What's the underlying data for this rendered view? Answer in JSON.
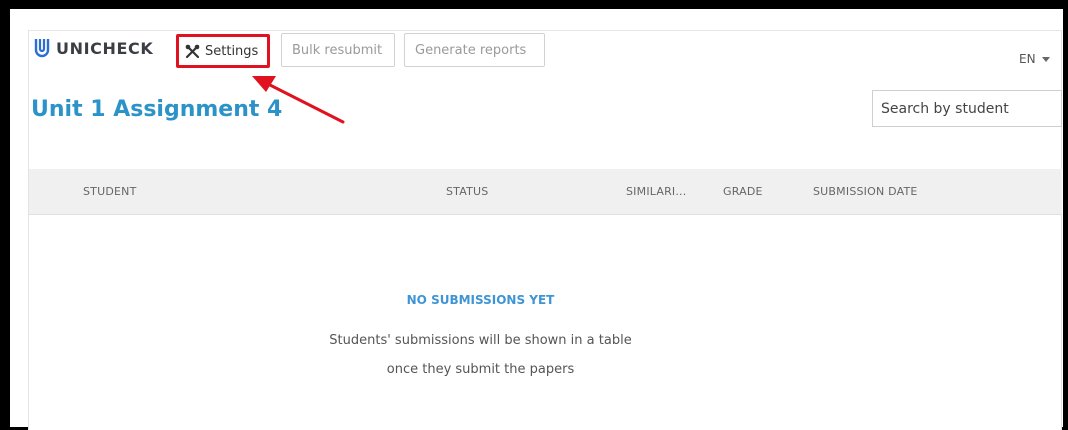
{
  "brand": {
    "name": "UNICHECK",
    "color": "#2b6fd4"
  },
  "toolbar": {
    "settings_label": "Settings",
    "bulk_resubmit_label": "Bulk resubmit",
    "generate_reports_label": "Generate reports"
  },
  "language": {
    "selected": "EN"
  },
  "assignment": {
    "title": "Unit 1 Assignment 4"
  },
  "search": {
    "placeholder": "Search by student"
  },
  "table": {
    "columns": [
      "STUDENT",
      "STATUS",
      "SIMILARI...",
      "GRADE",
      "SUBMISSION DATE"
    ]
  },
  "empty_state": {
    "title": "NO SUBMISSIONS YET",
    "line1": "Students' submissions will be shown in a table",
    "line2": "once they submit the papers"
  },
  "annotation": {
    "highlight_color": "#e0121f",
    "target": "settings-button"
  },
  "colors": {
    "title": "#2b93c7",
    "empty_title": "#3f95d4",
    "header_bg": "#f0f0f0"
  }
}
